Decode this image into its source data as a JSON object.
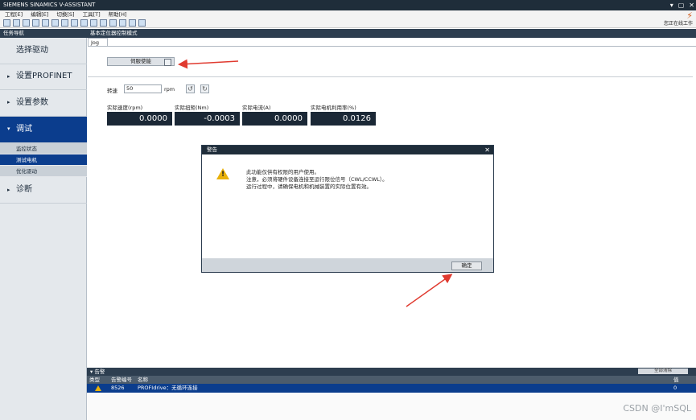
{
  "window": {
    "title": "SIEMENS SINAMICS V-ASSISTANT",
    "controls": [
      "▾",
      "▢",
      "✕"
    ]
  },
  "menu": [
    {
      "label": "工程[E]"
    },
    {
      "label": "编辑[E]"
    },
    {
      "label": "切换[S]"
    },
    {
      "label": "工具[T]"
    },
    {
      "label": "帮助[H]"
    }
  ],
  "offline": {
    "label": "您正在线工作"
  },
  "nav": {
    "header": "任务导航",
    "items": [
      {
        "label": "选择驱动"
      },
      {
        "label": "设置PROFINET"
      },
      {
        "label": "设置参数"
      },
      {
        "label": "调试"
      },
      {
        "label": "诊断"
      }
    ],
    "subitems": [
      {
        "label": "监控状态"
      },
      {
        "label": "测试电机"
      },
      {
        "label": "优化驱动"
      }
    ]
  },
  "main": {
    "header": "基本定位器控制模式",
    "tab": "Jog",
    "servo_button": "伺服使能",
    "speed_label": "转速",
    "speed_value": "50",
    "speed_unit": "rpm",
    "readouts": [
      {
        "label": "实际速度(rpm)",
        "value": "0.0000"
      },
      {
        "label": "实际扭矩(Nm)",
        "value": "-0.0003"
      },
      {
        "label": "实际电流(A)",
        "value": "0.0000"
      },
      {
        "label": "实际电机利用率(%)",
        "value": "0.0126"
      }
    ]
  },
  "dialog": {
    "title": "警告",
    "lines": [
      "此功能仅供有权限的用户使用。",
      "注意，必须将硬件设备连接至运行限位信号（CWL/CCWL）。",
      "运行过程中，请确保电机和机械装置的实际位置有效。"
    ],
    "ok": "确定"
  },
  "alarm": {
    "header": "▾ 告警",
    "clear_button": "全部清除",
    "columns": {
      "type": "类型",
      "code": "告警编号",
      "name": "名称",
      "count": "值"
    },
    "row": {
      "code": "8526",
      "name": "PROFIdrive：无循环连接",
      "count": "0"
    }
  },
  "watermark": "CSDN @I'mSQL",
  "colors": {
    "accent": "#0b3d8d",
    "dark": "#2d3e50",
    "arrow": "#e03a2f",
    "warning": "#e9b10a"
  }
}
